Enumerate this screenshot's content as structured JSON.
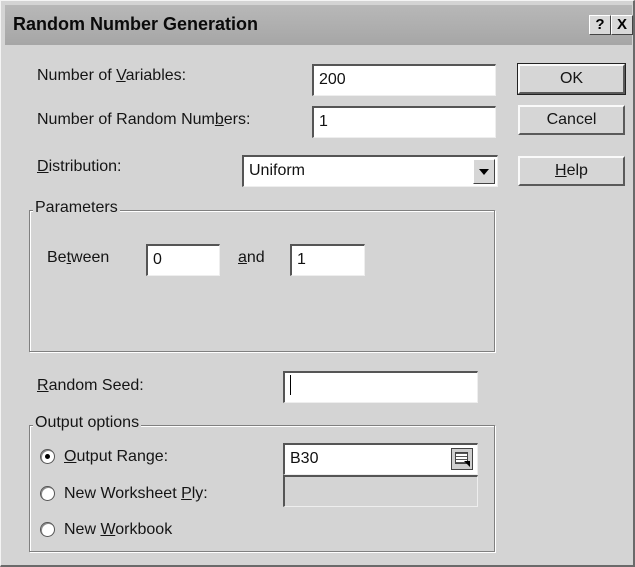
{
  "dialog": {
    "title": "Random Number Generation",
    "help_glyph": "?",
    "close_glyph": "X"
  },
  "fields": {
    "num_variables_label_pre": "Number of ",
    "num_variables_label_u": "V",
    "num_variables_label_post": "ariables:",
    "num_variables_value": "200",
    "num_random_label_pre": "Number of Random Num",
    "num_random_label_u": "b",
    "num_random_label_post": "ers:",
    "num_random_value": "1",
    "distribution_label_u": "D",
    "distribution_label_post": "istribution:",
    "distribution_value": "Uniform"
  },
  "buttons": {
    "ok": "OK",
    "cancel": "Cancel",
    "help_u": "H",
    "help_post": "elp"
  },
  "parameters": {
    "legend": "Parameters",
    "between_pre": "Be",
    "between_u": "t",
    "between_post": "ween",
    "between_value": "0",
    "and_u": "a",
    "and_post": "nd",
    "and_value": "1"
  },
  "seed": {
    "label_u": "R",
    "label_post": "andom Seed:",
    "value": ""
  },
  "output": {
    "legend": "Output options",
    "range_u": "O",
    "range_post": "utput Range:",
    "range_value": "B30",
    "range_selected": true,
    "worksheet_pre": "New Worksheet ",
    "worksheet_u": "P",
    "worksheet_post": "ly:",
    "worksheet_value": "",
    "workbook_pre": "New ",
    "workbook_u": "W",
    "workbook_post": "orkbook"
  },
  "icons": {
    "distribution_dropdown": "chevron-down-icon",
    "range_picker": "collapse-dialog-icon"
  }
}
